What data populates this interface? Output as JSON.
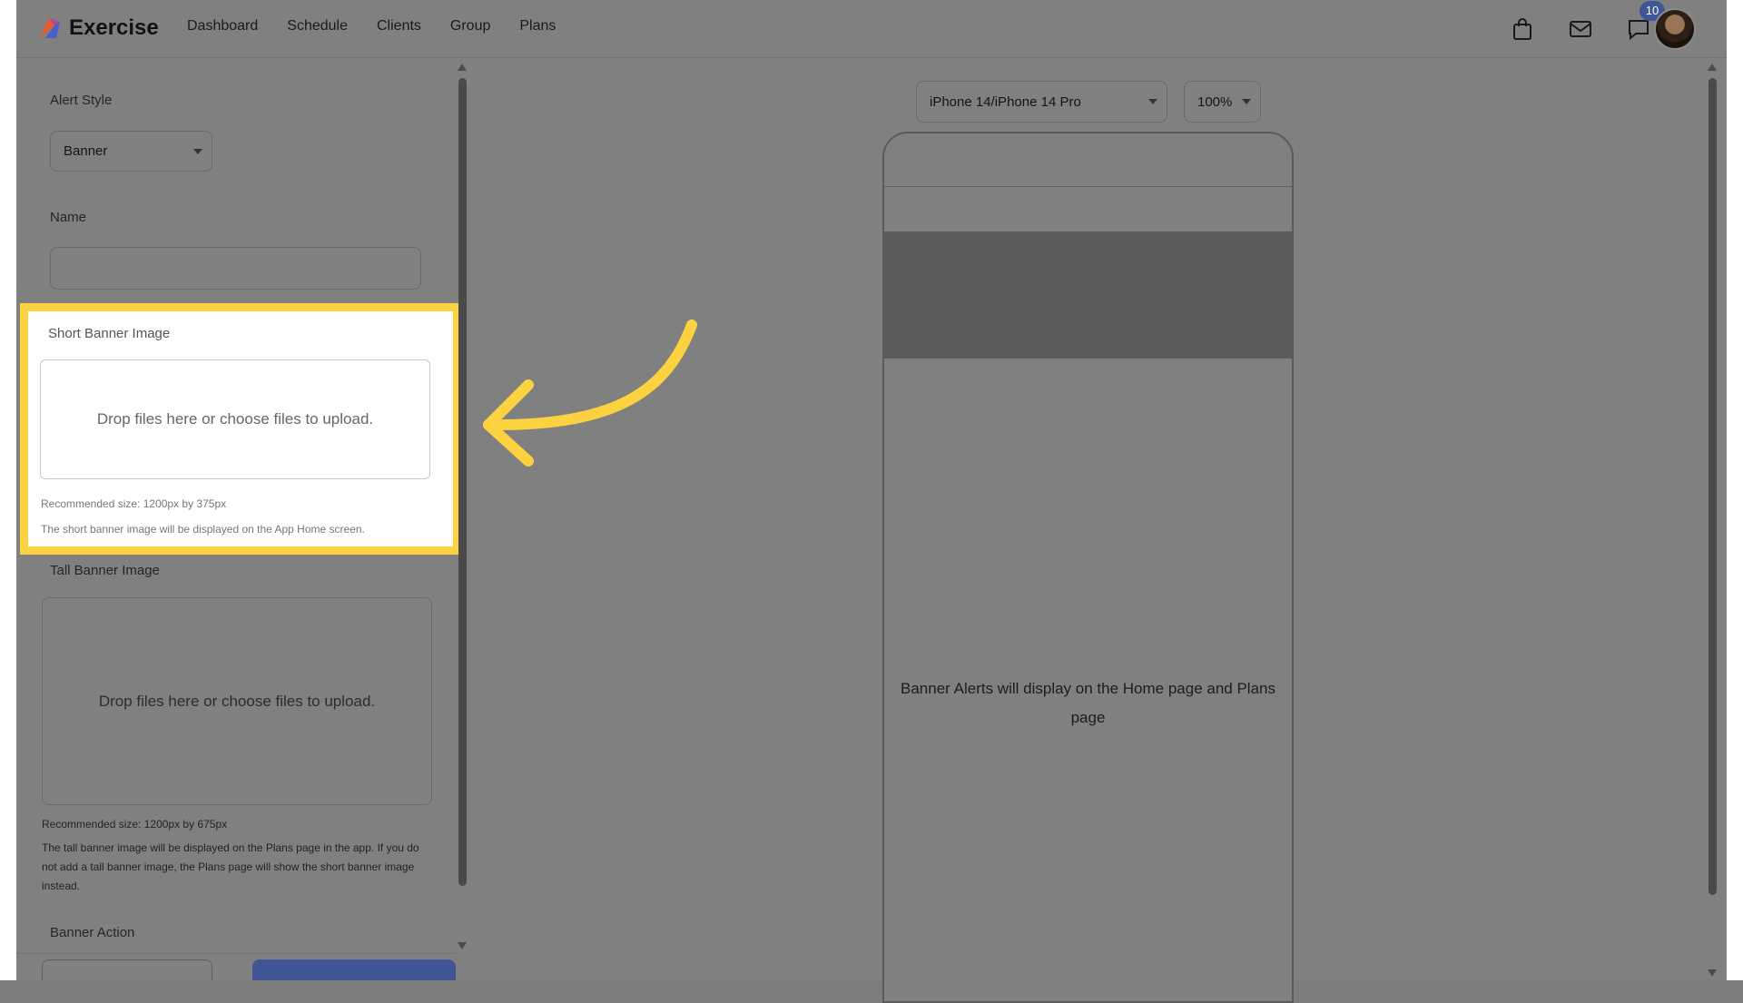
{
  "app": {
    "title": "Exercise"
  },
  "nav": {
    "items": [
      "Dashboard",
      "Schedule",
      "Clients",
      "Group",
      "Plans"
    ]
  },
  "top_icons": {
    "cart": "shopping-bag-icon",
    "mail": "mail-icon",
    "chat": "chat-icon",
    "chat_badge": "10"
  },
  "form": {
    "alert_style": {
      "label": "Alert Style",
      "value": "Banner"
    },
    "name": {
      "label": "Name",
      "value": ""
    },
    "short_banner": {
      "label": "Short Banner Image",
      "dropzone": "Drop files here or choose files to upload.",
      "size_hint": "Recommended size: 1200px by 375px",
      "description": "The short banner image will be displayed on the App Home screen."
    },
    "tall_banner": {
      "label": "Tall Banner Image",
      "dropzone": "Drop files here or choose files to upload.",
      "size_hint": "Recommended size: 1200px by 675px",
      "description": "The tall banner image will be displayed on the Plans page in the app. If you do not add a tall banner image, the Plans page will show the short banner image instead."
    },
    "banner_action": {
      "label": "Banner Action"
    }
  },
  "preview": {
    "device": "iPhone 14/iPhone 14 Pro",
    "zoom": "100%",
    "message": "Banner Alerts will display on the Home page and Plans page"
  },
  "colors": {
    "highlight": "#fcd240",
    "accent": "#3f5596",
    "overlay": "#808080"
  }
}
